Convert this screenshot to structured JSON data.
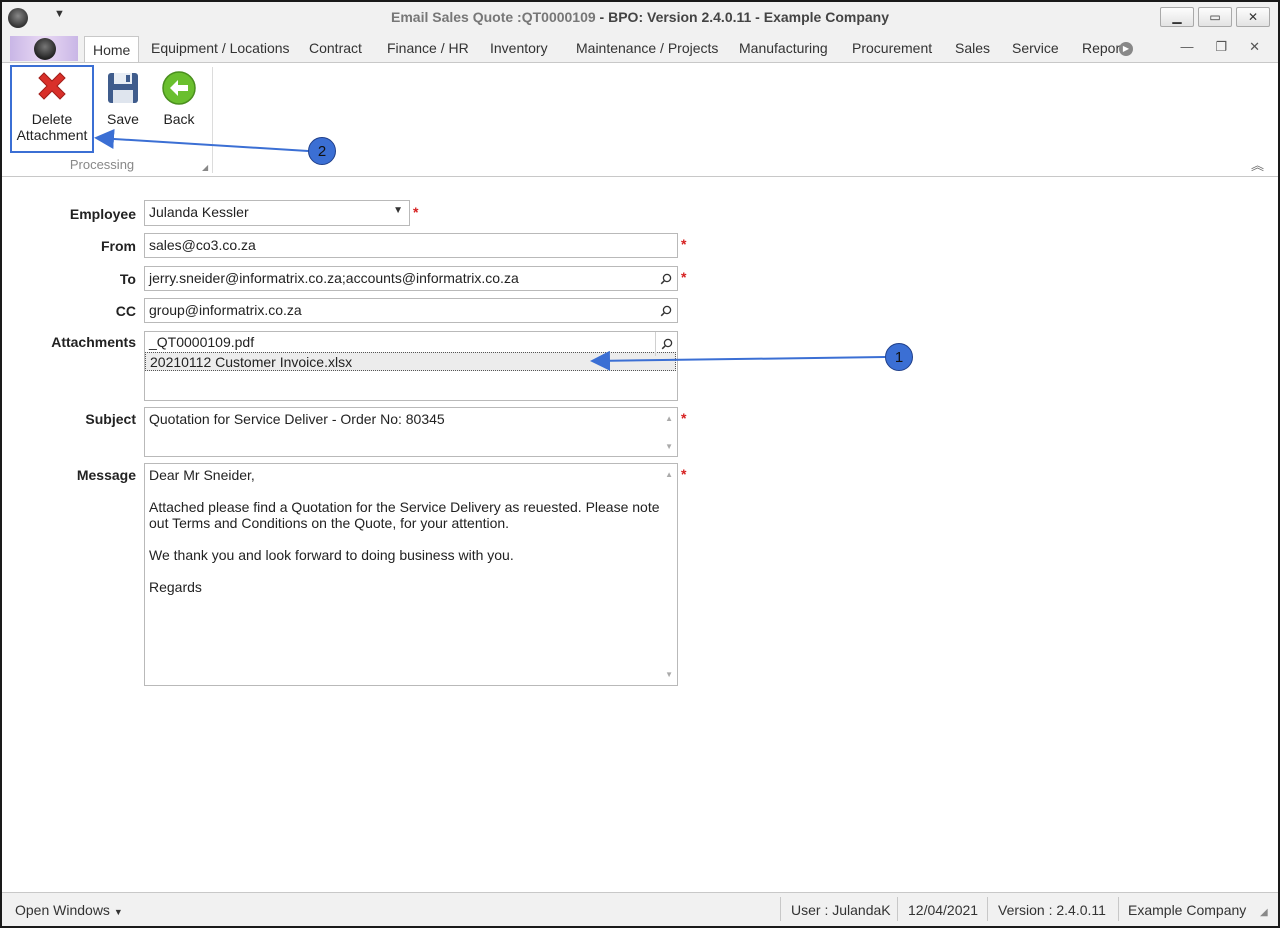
{
  "window": {
    "title_doc": "Email Sales Quote :QT0000109",
    "title_sep": " - ",
    "title_app": "BPO: Version 2.4.0.11 - Example Company",
    "minimize_icon": "minimize-icon",
    "maximize_icon": "maximize-icon",
    "close_icon": "close-icon"
  },
  "ribbon": {
    "tabs": [
      {
        "label": "Home"
      },
      {
        "label": "Equipment / Locations"
      },
      {
        "label": "Contract"
      },
      {
        "label": "Finance / HR"
      },
      {
        "label": "Inventory"
      },
      {
        "label": "Maintenance / Projects"
      },
      {
        "label": "Manufacturing"
      },
      {
        "label": "Procurement"
      },
      {
        "label": "Sales"
      },
      {
        "label": "Service"
      },
      {
        "label": "Repor"
      }
    ],
    "buttons": {
      "delete_line1": "Delete",
      "delete_line2": "Attachment",
      "save": "Save",
      "back": "Back"
    },
    "group_label": "Processing"
  },
  "form": {
    "employee": {
      "label": "Employee",
      "value": "Julanda Kessler"
    },
    "from": {
      "label": "From",
      "value": "sales@co3.co.za"
    },
    "to": {
      "label": "To",
      "value": "jerry.sneider@informatrix.co.za;accounts@informatrix.co.za"
    },
    "cc": {
      "label": "CC",
      "value": "group@informatrix.co.za"
    },
    "attachments": {
      "label": "Attachments",
      "items": [
        "_QT0000109.pdf",
        "20210112 Customer Invoice.xlsx"
      ]
    },
    "subject": {
      "label": "Subject",
      "value": "Quotation for Service Deliver - Order No: 80345"
    },
    "message": {
      "label": "Message",
      "lines": [
        "Dear Mr Sneider,",
        "",
        "Attached please find a Quotation for the Service Delivery as reuested.  Please note",
        "out Terms and Conditions on the Quote, for your attention.",
        "",
        "We thank you and look forward to doing business with you.",
        "",
        "Regards"
      ]
    },
    "required_mark": "*"
  },
  "callouts": {
    "one": "1",
    "two": "2"
  },
  "statusbar": {
    "open_windows": "Open Windows",
    "user": "User : JulandaK",
    "date": "12/04/2021",
    "version": "Version : 2.4.0.11",
    "company": "Example Company"
  },
  "colors": {
    "accent": "#3b6fd4",
    "required": "#d62020",
    "delete_red": "#d9302a",
    "back_green": "#6abf2e"
  }
}
